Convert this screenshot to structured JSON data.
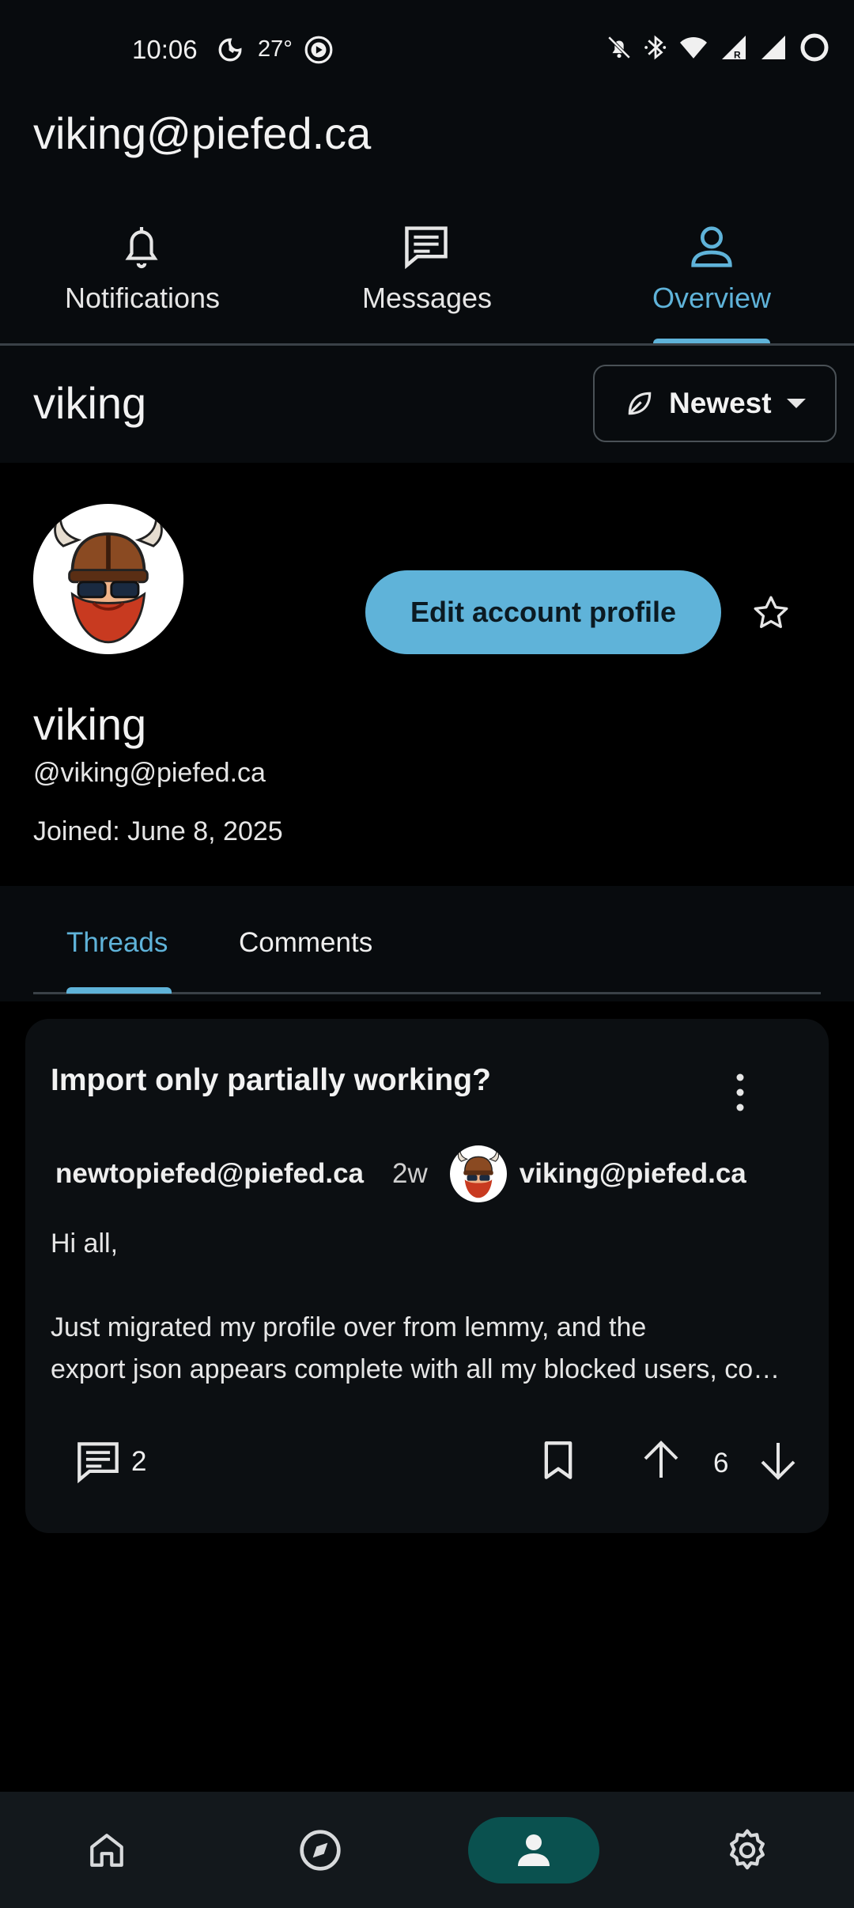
{
  "status_bar": {
    "time": "10:06",
    "temperature": "27°",
    "icons": [
      "weather-icon",
      "app-icon",
      "mute-icon",
      "bluetooth-icon",
      "wifi-icon",
      "signal-roaming-icon",
      "signal-icon",
      "battery-ring-icon"
    ]
  },
  "header": {
    "account": "viking@piefed.ca"
  },
  "top_tabs": [
    {
      "label": "Notifications",
      "icon": "bell-icon",
      "active": false
    },
    {
      "label": "Messages",
      "icon": "message-icon",
      "active": false
    },
    {
      "label": "Overview",
      "icon": "person-icon",
      "active": true
    }
  ],
  "subheader": {
    "title": "viking",
    "sort_label": "Newest",
    "sort_icon": "leaf-icon"
  },
  "profile": {
    "name": "viking",
    "handle": "@viking@piefed.ca",
    "joined": "Joined: June 8, 2025",
    "edit_button": "Edit account profile"
  },
  "content_tabs": [
    {
      "label": "Threads",
      "active": true
    },
    {
      "label": "Comments",
      "active": false
    }
  ],
  "post": {
    "title": "Import only partially working?",
    "author": "newtopiefed@piefed.ca",
    "age": "2w",
    "owner": "viking@piefed.ca",
    "body_line_1": "Hi all,",
    "body_line_2": "Just migrated my profile over from lemmy, and the",
    "body_line_3": "export json appears complete with all my blocked users, communities, and more",
    "comment_count": "2",
    "score": "6"
  },
  "bottom_nav": [
    {
      "icon": "home-icon",
      "active": false
    },
    {
      "icon": "explore-icon",
      "active": false
    },
    {
      "icon": "profile-icon",
      "active": true
    },
    {
      "icon": "settings-icon",
      "active": false
    }
  ],
  "colors": {
    "accent": "#5fb3d9",
    "background": "#000000",
    "surface": "#080b0e",
    "card": "#0c0f12",
    "nav_active": "#0a514f"
  }
}
